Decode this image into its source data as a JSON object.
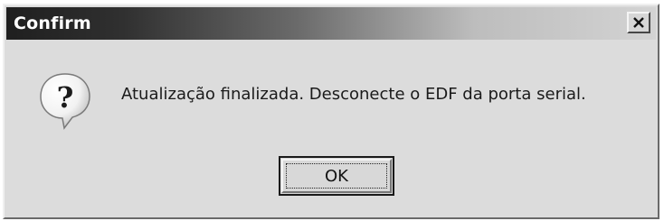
{
  "dialog": {
    "title": "Confirm",
    "close_icon": "close-x-icon",
    "icon": "question-icon",
    "message": "Atualização finalizada. Desconecte o EDF da porta serial.",
    "ok_label": "OK"
  }
}
